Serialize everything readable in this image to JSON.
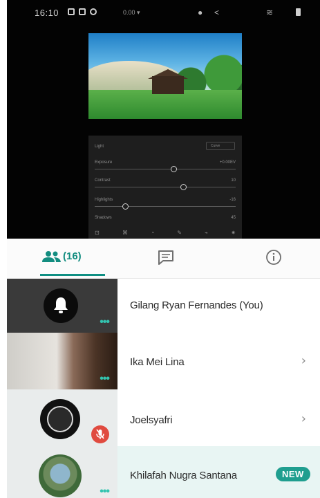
{
  "status_bar": {
    "time": "16:10",
    "speed": "0.00 ▾"
  },
  "editor": {
    "panel_title": "Light",
    "pill_label": "Curve",
    "sliders": [
      {
        "label": "Exposure",
        "value": "+0.00EV",
        "level": 0.56
      },
      {
        "label": "Contrast",
        "value": "10",
        "level": 0.63
      },
      {
        "label": "Highlights",
        "value": "-16",
        "level": 0.22
      },
      {
        "label": "Shadows",
        "value": "45",
        "level": 0.7
      }
    ]
  },
  "tabs": {
    "participants_count": "(16)",
    "active_color": "#0f8f83"
  },
  "participants": [
    {
      "name": "Gilang Ryan Fernandes (You)"
    },
    {
      "name": "Ika Mei Lina"
    },
    {
      "name": "Joelsyafri"
    },
    {
      "name": "Khilafah Nugra Santana",
      "badge": "NEW"
    }
  ],
  "chevron": "›",
  "colors": {
    "accent": "#1f9e8f",
    "mute": "#e04a3f",
    "highlight_row": "#e8f5f3"
  }
}
